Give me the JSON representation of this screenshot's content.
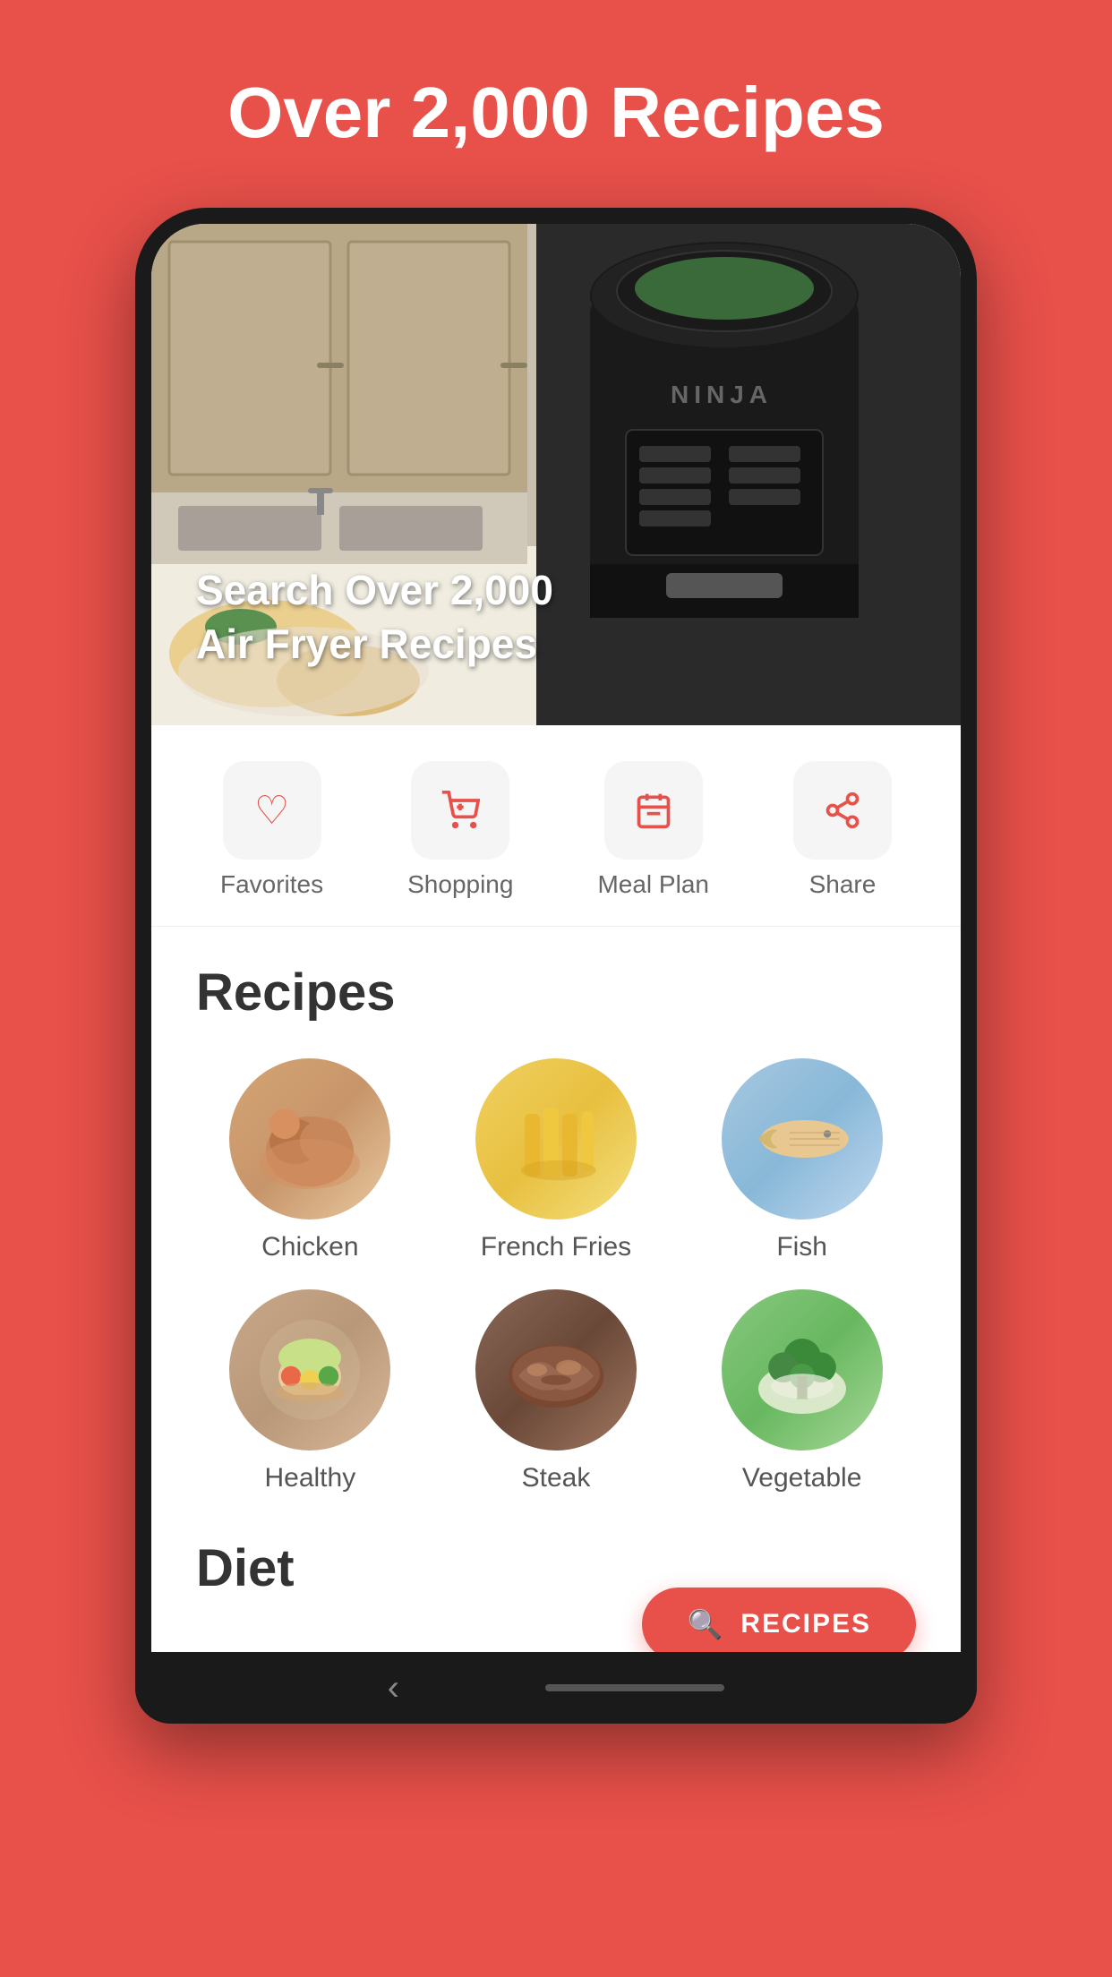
{
  "header": {
    "title": "Over 2,000 Recipes"
  },
  "hero": {
    "search_text": "Search Over 2,000 Air Fryer Recipes",
    "airfryer_brand": "NINJA"
  },
  "quick_actions": [
    {
      "id": "favorites",
      "label": "Favorites",
      "icon": "♡"
    },
    {
      "id": "shopping",
      "label": "Shopping",
      "icon": "🛒"
    },
    {
      "id": "meal_plan",
      "label": "Meal Plan",
      "icon": "📅"
    },
    {
      "id": "share",
      "label": "Share",
      "icon": "↗"
    }
  ],
  "recipes_section": {
    "title": "Recipes",
    "items": [
      {
        "id": "chicken",
        "label": "Chicken",
        "emoji": "🍗",
        "class": "chicken"
      },
      {
        "id": "french-fries",
        "label": "French Fries",
        "emoji": "🍟",
        "class": "fries"
      },
      {
        "id": "fish",
        "label": "Fish",
        "emoji": "🐟",
        "class": "fish"
      },
      {
        "id": "healthy",
        "label": "Healthy",
        "emoji": "🥗",
        "class": "healthy"
      },
      {
        "id": "steak",
        "label": "Steak",
        "emoji": "🥩",
        "class": "steak"
      },
      {
        "id": "vegetable",
        "label": "Vegetable",
        "emoji": "🥦",
        "class": "vegetable"
      }
    ]
  },
  "diet_section": {
    "title": "Diet"
  },
  "search_button": {
    "label": "RECIPES",
    "icon": "🔍"
  },
  "nav": {
    "back_icon": "‹"
  },
  "colors": {
    "primary": "#E8504A",
    "white": "#ffffff",
    "dark": "#333333",
    "medium": "#555555",
    "light_bg": "#f5f5f5"
  }
}
